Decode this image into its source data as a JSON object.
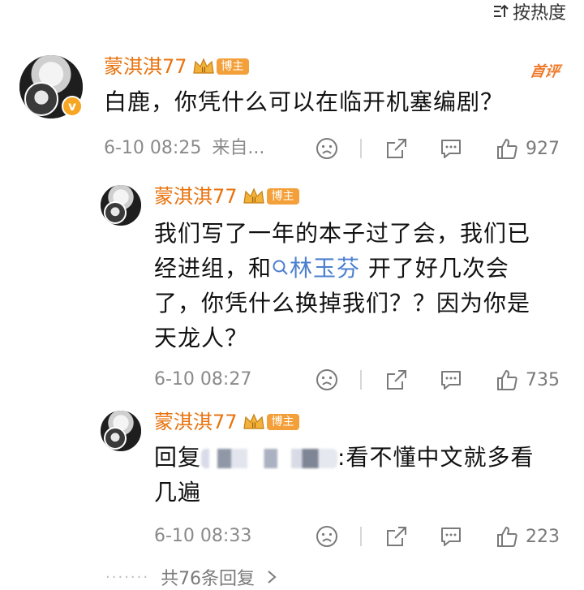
{
  "header": {
    "sort_label": "按热度"
  },
  "comment": {
    "username": "蒙淇淇77",
    "badge_tag": "博主",
    "first_badge": "首评",
    "text": "白鹿，你凭什么可以在临开机塞编剧？",
    "time": "6-10 08:25",
    "source": "来自...",
    "likes": "927",
    "replies": [
      {
        "username": "蒙淇淇77",
        "badge_tag": "博主",
        "text_before": "我们写了一年的本子过了会，我们已经进组，和",
        "mention": "林玉芬",
        "text_after": " 开了好几次会了，你凭什么换掉我们？？因为你是天龙人？",
        "time": "6-10 08:27",
        "likes": "735"
      },
      {
        "username": "蒙淇淇77",
        "badge_tag": "博主",
        "reply_prefix": "回复",
        "text_after": ":看不懂中文就多看几遍",
        "time": "6-10 08:33",
        "likes": "223"
      }
    ],
    "more_replies": "共76条回复",
    "more_dots": "·······"
  },
  "colors": {
    "username": "#e8730f",
    "badge": "#f4a03a",
    "link": "#4b7fd0",
    "meta": "#8a8a8a"
  },
  "icons": [
    "sort-icon",
    "vip-crown-icon",
    "verified-v-icon",
    "dislike-face-icon",
    "share-icon",
    "comment-icon",
    "like-icon",
    "chevron-right-icon"
  ]
}
